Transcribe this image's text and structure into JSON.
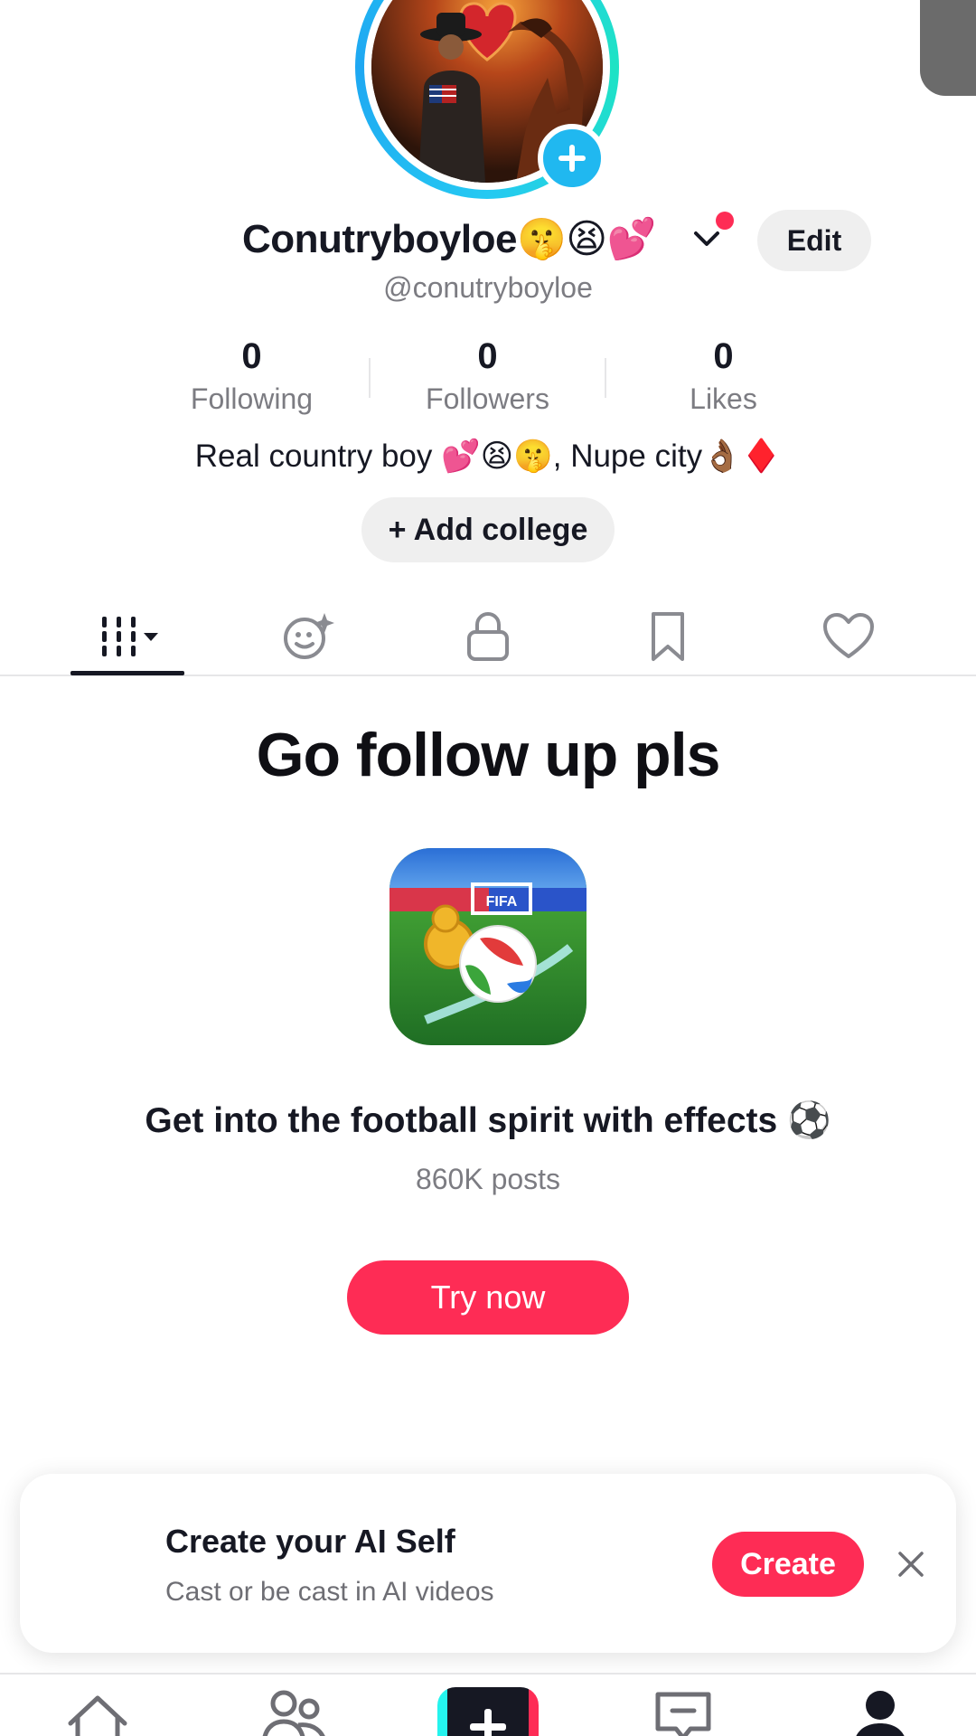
{
  "profile": {
    "display_name": "Conutryboyloe🤫😫💕",
    "username": "@conutryboyloe",
    "edit_label": "Edit",
    "bio": "Real country boy 💕😫🤫, Nupe city👌🏾♦️",
    "add_college_label": "+ Add college"
  },
  "stats": [
    {
      "value": "0",
      "label": "Following"
    },
    {
      "value": "0",
      "label": "Followers"
    },
    {
      "value": "0",
      "label": "Likes"
    }
  ],
  "promo": {
    "title": "Go follow up pls",
    "icon_text": "FIFA",
    "heading": "Get into the football spirit with effects ⚽",
    "posts": "860K posts",
    "button_label": "Try now"
  },
  "ai_card": {
    "title": "Create your AI Self",
    "subtitle": "Cast or be cast in AI videos",
    "create_label": "Create"
  },
  "colors": {
    "accent": "#fe2c55",
    "avatar_ring": "#25c9f2",
    "text_primary": "#161823",
    "text_secondary": "#7c7c82"
  },
  "icons": {
    "tabs": [
      "grid-filter-icon",
      "ai-face-icon",
      "lock-icon",
      "bookmark-icon",
      "heart-icon"
    ],
    "nav": [
      "home-icon",
      "friends-icon",
      "create-plus-icon",
      "inbox-icon",
      "profile-icon"
    ]
  }
}
